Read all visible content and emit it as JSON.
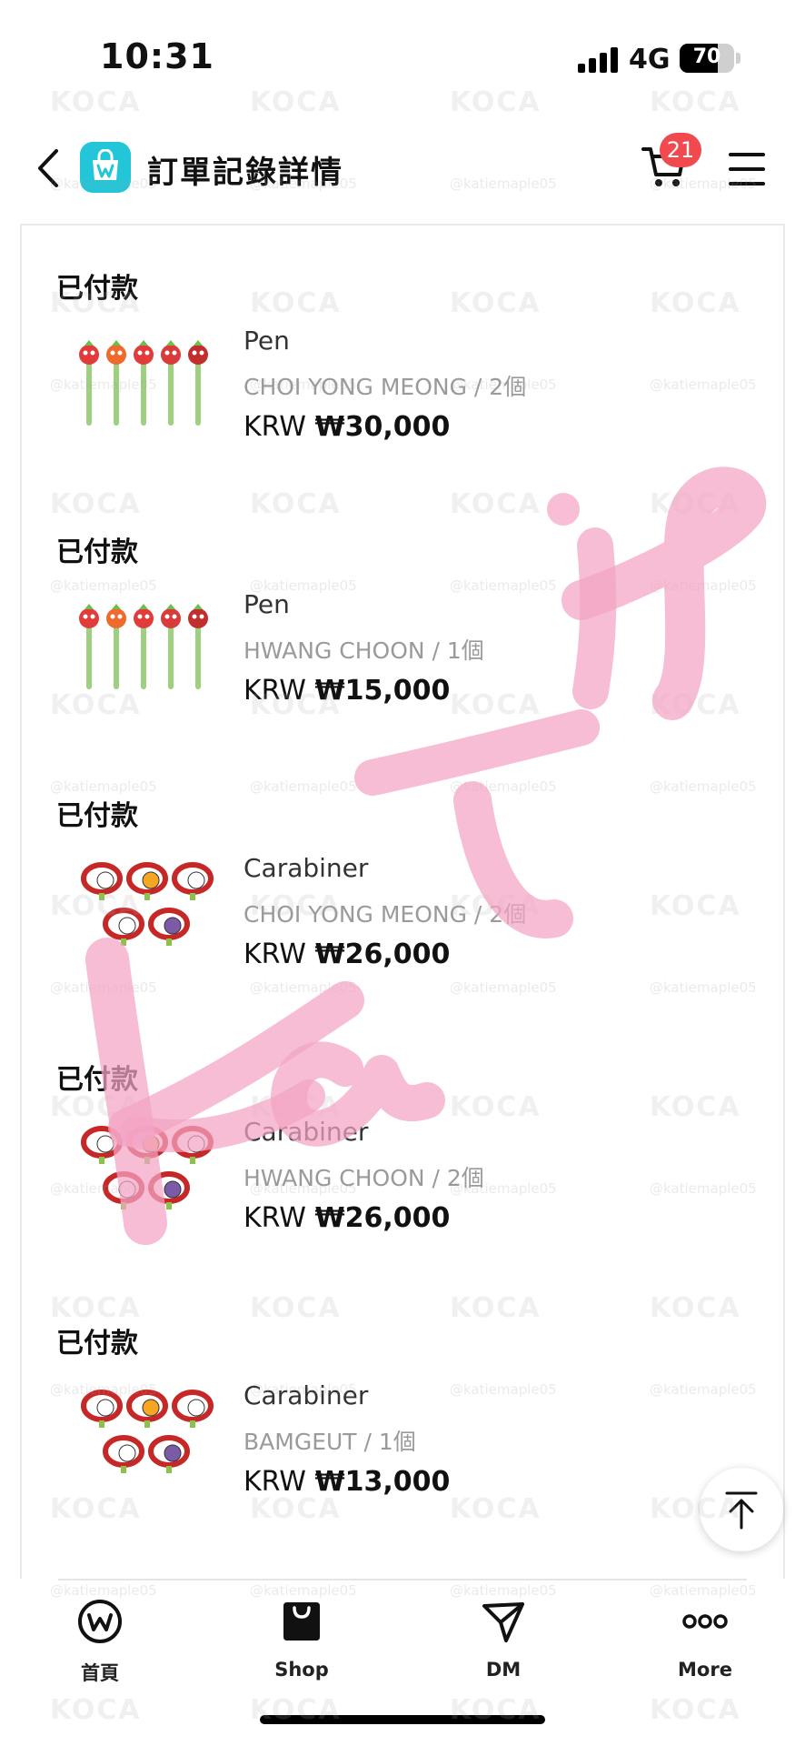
{
  "status_bar": {
    "time": "10:31",
    "network": "4G",
    "battery": "70",
    "battery_level": 0.7
  },
  "header": {
    "back_icon": "chevron-left-icon",
    "app_icon": "shopping-bag-w-icon",
    "title": "訂單記錄詳情",
    "cart_icon": "cart-icon",
    "cart_count": "21",
    "menu_icon": "hamburger-menu-icon"
  },
  "orders": [
    {
      "status": "已付款",
      "name": "Pen",
      "variant": "CHOI YONG MEONG / 2個",
      "currency": "KRW",
      "amount": "₩30,000",
      "thumb": "pen"
    },
    {
      "status": "已付款",
      "name": "Pen",
      "variant": "HWANG CHOON / 1個",
      "currency": "KRW",
      "amount": "₩15,000",
      "thumb": "pen"
    },
    {
      "status": "已付款",
      "name": "Carabiner",
      "variant": "CHOI YONG MEONG / 2個",
      "currency": "KRW",
      "amount": "₩26,000",
      "thumb": "carabiner"
    },
    {
      "status": "已付款",
      "name": "Carabiner",
      "variant": "HWANG CHOON / 2個",
      "currency": "KRW",
      "amount": "₩26,000",
      "thumb": "carabiner"
    },
    {
      "status": "已付款",
      "name": "Carabiner",
      "variant": "BAMGEUT / 1個",
      "currency": "KRW",
      "amount": "₩13,000",
      "thumb": "carabiner"
    }
  ],
  "scroll_top_icon": "arrow-up-to-top-icon",
  "tabs": [
    {
      "label": "首頁",
      "icon": "weverse-w-icon"
    },
    {
      "label": "Shop",
      "icon": "shopping-bag-icon"
    },
    {
      "label": "DM",
      "icon": "paper-plane-icon"
    },
    {
      "label": "More",
      "icon": "three-dots-icon"
    }
  ],
  "watermark": {
    "logo": "KOCA",
    "handle": "@katiemaple05",
    "signature": "Katie"
  },
  "colors": {
    "brand": "#22c6d8",
    "badge": "#f04a4f",
    "signature": "#f3a3c3"
  }
}
